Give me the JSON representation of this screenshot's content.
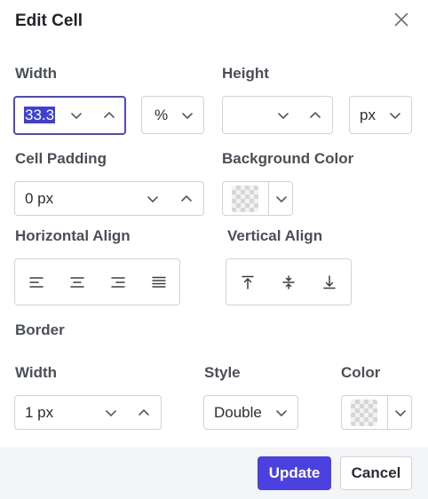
{
  "dialog": {
    "title": "Edit Cell",
    "close_icon": "close-icon"
  },
  "size": {
    "width_label": "Width",
    "width_value": "33.3",
    "width_unit": "%",
    "height_label": "Height",
    "height_value": "",
    "height_unit": "px"
  },
  "padding": {
    "label": "Cell Padding",
    "value": "0 px"
  },
  "background": {
    "label": "Background Color",
    "swatch": "transparent-checkerboard"
  },
  "horizontal_align": {
    "label": "Horizontal Align",
    "options": [
      "align-left-icon",
      "align-center-icon",
      "align-right-icon",
      "align-justify-icon"
    ]
  },
  "vertical_align": {
    "label": "Vertical Align",
    "options": [
      "align-top-icon",
      "align-middle-icon",
      "align-bottom-icon"
    ]
  },
  "border": {
    "section_label": "Border",
    "width_label": "Width",
    "width_value": "1 px",
    "style_label": "Style",
    "style_value": "Double",
    "color_label": "Color"
  },
  "footer": {
    "update_label": "Update",
    "cancel_label": "Cancel"
  },
  "colors": {
    "accent": "#4b40e0",
    "focus_border": "#4c46d6",
    "text_selection": "#3f3fd8",
    "label": "#4a4f57",
    "border": "#cfd3d8",
    "footer_bg": "#f4f5f7"
  }
}
